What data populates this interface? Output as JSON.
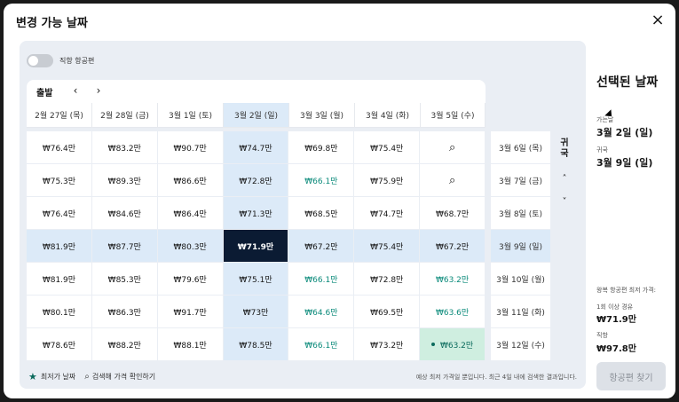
{
  "dialog": {
    "title": "변경 가능 날짜",
    "close_icon": "×"
  },
  "toggle": {
    "label": "직항 항공편"
  },
  "depart": {
    "label": "출발",
    "prev": "‹",
    "next": "›"
  },
  "columns": [
    "2월 27일 (목)",
    "2월 28일 (금)",
    "3월 1일 (토)",
    "3월 2일 (일)",
    "3월 3일 (월)",
    "3월 4일 (화)",
    "3월 5일 (수)"
  ],
  "rows": [
    [
      "₩76.4만",
      "₩83.2만",
      "₩90.7만",
      "₩74.7만",
      "₩69.8만",
      "₩75.4만",
      "search"
    ],
    [
      "₩75.3만",
      "₩89.3만",
      "₩86.6만",
      "₩72.8만",
      "₩66.1만",
      "₩75.9만",
      "search"
    ],
    [
      "₩76.4만",
      "₩84.6만",
      "₩86.4만",
      "₩71.3만",
      "₩68.5만",
      "₩74.7만",
      "₩68.7만"
    ],
    [
      "₩81.9만",
      "₩87.7만",
      "₩80.3만",
      "₩71.9만",
      "₩67.2만",
      "₩75.4만",
      "₩67.2만"
    ],
    [
      "₩81.9만",
      "₩85.3만",
      "₩79.6만",
      "₩75.1만",
      "₩66.1만",
      "₩72.8만",
      "₩63.2만"
    ],
    [
      "₩80.1만",
      "₩86.3만",
      "₩91.7만",
      "₩73만",
      "₩64.6만",
      "₩69.5만",
      "₩63.6만"
    ],
    [
      "₩78.6만",
      "₩88.2만",
      "₩88.1만",
      "₩78.5만",
      "₩66.1만",
      "₩73.2만",
      "₩63.2만"
    ]
  ],
  "return_dates": [
    "3월 6일 (목)",
    "3월 7일 (금)",
    "3월 8일 (토)",
    "3월 9일 (일)",
    "3월 10일 (월)",
    "3월 11일 (화)",
    "3월 12일 (수)"
  ],
  "return_head": [
    "귀",
    "국"
  ],
  "return_nav": {
    "up": "˄",
    "down": "˅"
  },
  "footer": {
    "lowest_label": "최저가 날짜",
    "search_label": "검색해 가격 확인하기",
    "note": "예상 최저 가격일 뿐입니다. 최근 4일 내에 검색한 결과입니다."
  },
  "side": {
    "title": "선택된 날짜",
    "depart_label": "가는날",
    "depart_value": "3월 2일 (일)",
    "return_label": "귀국",
    "return_value": "3월 9일 (일)",
    "lowest_title": "왕복 항공편 최저 가격:",
    "stop_label": "1회 이상 경유",
    "stop_price": "₩71.9만",
    "direct_label": "직항",
    "direct_price": "₩97.8만",
    "search_button": "항공편 찾기"
  },
  "colors": {
    "selected": "#0b1b33",
    "highlight": "#dceaf8",
    "cheap": "#0a8a7a",
    "best": "#cfeee0"
  }
}
